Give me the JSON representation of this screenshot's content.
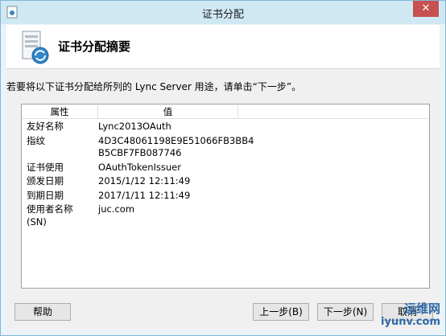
{
  "window": {
    "title": "证书分配",
    "close_glyph": "✕"
  },
  "header": {
    "title": "证书分配摘要"
  },
  "instruction": "若要将以下证书分配给所列的 Lync Server 用途，请单击“下一步”。",
  "list": {
    "columns": [
      "属性",
      "值"
    ],
    "rows": [
      {
        "prop": "友好名称",
        "value": "Lync2013OAuth"
      },
      {
        "prop": "指纹",
        "value": "4D3C48061198E9E51066FB3BB4\nB5CBF7FB087746"
      },
      {
        "prop": "证书使用",
        "value": "OAuthTokenIssuer"
      },
      {
        "prop": "颁发日期",
        "value": "2015/1/12 12:11:49"
      },
      {
        "prop": "到期日期",
        "value": "2017/1/11 12:11:49"
      },
      {
        "prop": "使用者名称(SN)",
        "value": "juc.com"
      }
    ]
  },
  "buttons": {
    "help": "帮助",
    "prev": "上一步(B)",
    "next": "下一步(N)",
    "cancel": "取消"
  },
  "watermark": {
    "top": "运维网",
    "bottom": "iyunv.com"
  },
  "icons": {
    "app": "app-icon",
    "header": "certificate-server-icon",
    "close": "close-icon"
  }
}
